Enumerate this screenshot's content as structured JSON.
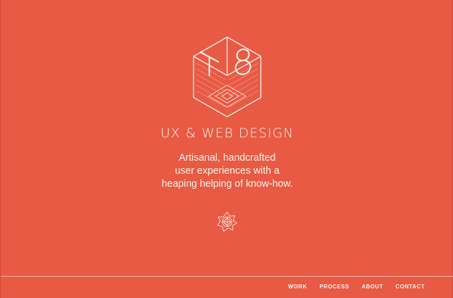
{
  "brand": {
    "logo_letters": "T8",
    "logo_icon": "isometric-cube-logo-icon",
    "emblem_icon": "ornamental-star-emblem-icon"
  },
  "hero": {
    "tagline": "UX & WEB DESIGN",
    "intro_lines": [
      "Artisanal, handcrafted",
      "user experiences with a",
      "heaping helping of know-how."
    ]
  },
  "nav": {
    "items": [
      {
        "label": "WORK"
      },
      {
        "label": "PROCESS"
      },
      {
        "label": "ABOUT"
      },
      {
        "label": "CONTACT"
      }
    ]
  },
  "colors": {
    "background": "#e85a44",
    "foreground": "#f6efe4"
  }
}
